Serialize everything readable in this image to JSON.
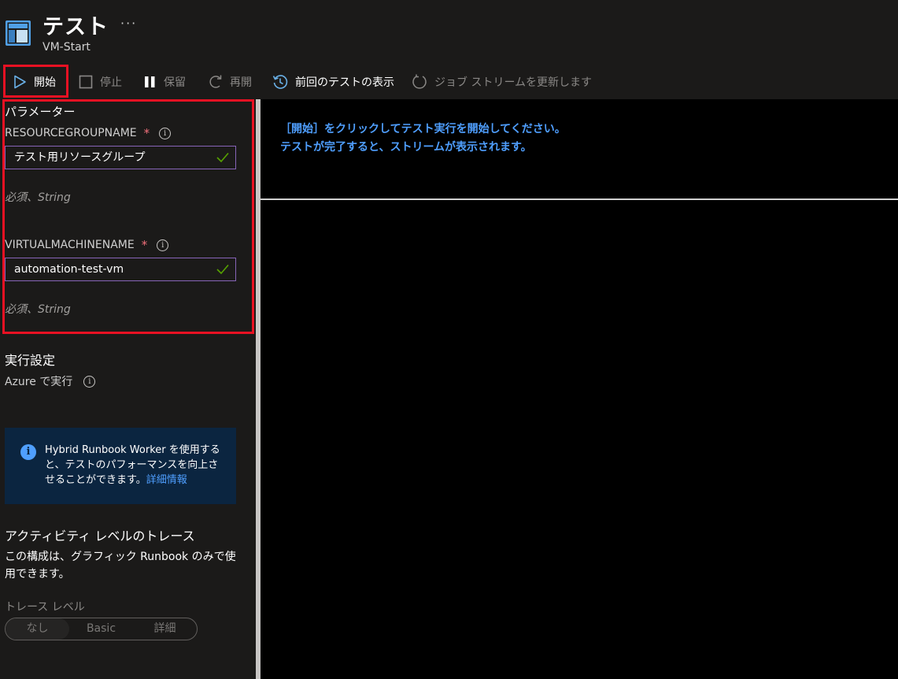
{
  "header": {
    "title": "テスト",
    "subtitle": "VM-Start",
    "more": "···"
  },
  "toolbar": {
    "start": "開始",
    "stop": "停止",
    "suspend": "保留",
    "resume": "再開",
    "previous_test": "前回のテストの表示",
    "refresh": "ジョブ ストリームを更新します"
  },
  "parameters": {
    "title": "パラメーター",
    "fields": [
      {
        "label": "RESOURCEGROUPNAME",
        "required": "*",
        "value": "テスト用リソースグループ",
        "hint": "必須、String"
      },
      {
        "label": "VIRTUALMACHINENAME",
        "required": "*",
        "value": "automation-test-vm",
        "hint": "必須、String"
      }
    ]
  },
  "run_settings": {
    "title": "実行設定",
    "run_on": "Azure で実行"
  },
  "info_card": {
    "text": "Hybrid Runbook Worker を使用すると、テストのパフォーマンスを向上させることができます。",
    "link": "詳細情報"
  },
  "trace": {
    "title": "アクティビティ レベルのトレース",
    "description": "この構成は、グラフィック Runbook のみで使用できます。",
    "level_label": "トレース レベル",
    "options": [
      "なし",
      "Basic",
      "詳細"
    ],
    "selected": "なし"
  },
  "output": {
    "line1": "［開始］をクリックしてテスト実行を開始してください。",
    "line2": "テストが完了すると、ストリームが表示されます。"
  },
  "colors": {
    "accent": "#4f9fff",
    "highlight_border": "#e81123",
    "valid_check": "#57a300"
  },
  "icons": {
    "header": "runbook-icon",
    "start": "play-icon",
    "stop": "stop-icon",
    "suspend": "pause-icon",
    "resume": "resume-arrow-icon",
    "previous": "history-icon",
    "refresh": "refresh-icon"
  }
}
